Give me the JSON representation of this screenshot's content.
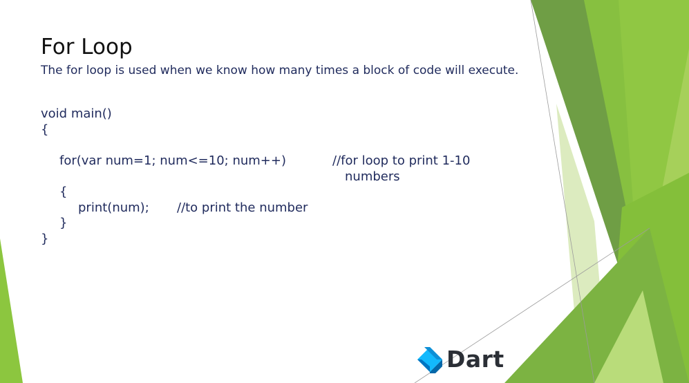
{
  "slide": {
    "title": "For Loop",
    "subtitle": "The for loop is used when we know how many times a block of code will execute."
  },
  "code": {
    "line1": "void main()",
    "line2": "{",
    "for_statement": "for(var num=1; num<=10; num++)",
    "for_comment_1": "//for loop to print 1-10",
    "for_comment_2": "numbers",
    "open_brace": "{",
    "print_statement": "print(num);",
    "print_comment": "//to print the number",
    "close_brace_inner": "}",
    "close_brace_outer": "}"
  },
  "logo": {
    "text": "Dart"
  },
  "theme": {
    "accent_green": "#8cc63f",
    "dark_green": "#5a9a2a",
    "dart_blue": "#0175c2",
    "dart_teal": "#13b9fd",
    "text_navy": "#1f2a5c"
  }
}
